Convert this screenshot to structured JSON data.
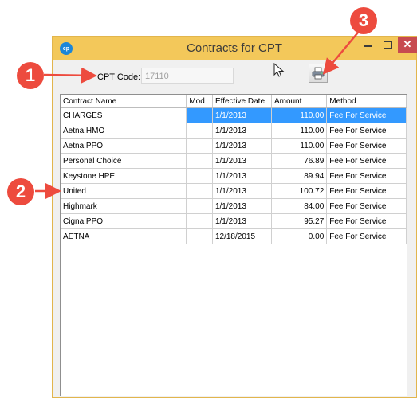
{
  "window": {
    "title": "Contracts for CPT",
    "app_icon_text": "cp",
    "close_symbol": "✕"
  },
  "form": {
    "cpt_label": "CPT Code:",
    "cpt_value": "17110"
  },
  "table": {
    "columns": [
      "Contract Name",
      "Mod",
      "Effective Date",
      "Amount",
      "Method"
    ],
    "rows": [
      {
        "name": "CHARGES",
        "mod": "",
        "date": "1/1/2013",
        "amount": "110.00",
        "method": "Fee For Service",
        "selected": true
      },
      {
        "name": "Aetna HMO",
        "mod": "",
        "date": "1/1/2013",
        "amount": "110.00",
        "method": "Fee For Service",
        "selected": false
      },
      {
        "name": "Aetna PPO",
        "mod": "",
        "date": "1/1/2013",
        "amount": "110.00",
        "method": "Fee For Service",
        "selected": false
      },
      {
        "name": "Personal Choice",
        "mod": "",
        "date": "1/1/2013",
        "amount": "76.89",
        "method": "Fee For Service",
        "selected": false
      },
      {
        "name": "Keystone HPE",
        "mod": "",
        "date": "1/1/2013",
        "amount": "89.94",
        "method": "Fee For Service",
        "selected": false
      },
      {
        "name": "United",
        "mod": "",
        "date": "1/1/2013",
        "amount": "100.72",
        "method": "Fee For Service",
        "selected": false
      },
      {
        "name": "Highmark",
        "mod": "",
        "date": "1/1/2013",
        "amount": "84.00",
        "method": "Fee For Service",
        "selected": false
      },
      {
        "name": "Cigna PPO",
        "mod": "",
        "date": "1/1/2013",
        "amount": "95.27",
        "method": "Fee For Service",
        "selected": false
      },
      {
        "name": "AETNA",
        "mod": "",
        "date": "12/18/2015",
        "amount": "0.00",
        "method": "Fee For Service",
        "selected": false
      }
    ]
  },
  "callouts": [
    "1",
    "2",
    "3"
  ],
  "colors": {
    "title_bar": "#f3c85a",
    "selection": "#3399ff",
    "callout": "#ed4b3e",
    "close_button": "#c74b50"
  },
  "icons": [
    "app-icon",
    "minimize-icon",
    "maximize-icon",
    "close-icon",
    "printer-icon",
    "mouse-cursor-icon"
  ]
}
